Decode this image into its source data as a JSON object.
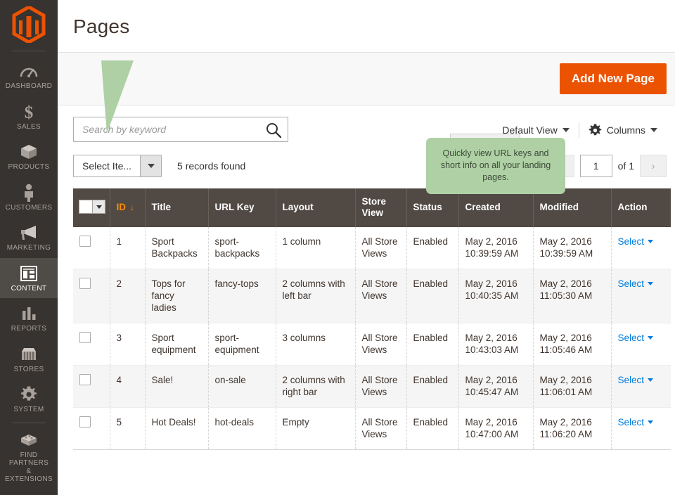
{
  "sidebar": {
    "logo_name": "magento-logo",
    "items": [
      {
        "label": "DASHBOARD",
        "icon": "dashboard-icon",
        "active": false
      },
      {
        "label": "SALES",
        "icon": "dollar-icon",
        "active": false
      },
      {
        "label": "PRODUCTS",
        "icon": "box-icon",
        "active": false
      },
      {
        "label": "CUSTOMERS",
        "icon": "person-icon",
        "active": false
      },
      {
        "label": "MARKETING",
        "icon": "megaphone-icon",
        "active": false
      },
      {
        "label": "CONTENT",
        "icon": "layout-icon",
        "active": true
      },
      {
        "label": "REPORTS",
        "icon": "bar-chart-icon",
        "active": false
      },
      {
        "label": "STORES",
        "icon": "storefront-icon",
        "active": false
      },
      {
        "label": "SYSTEM",
        "icon": "gear-icon",
        "active": false
      },
      {
        "label": "FIND PARTNERS\n& EXTENSIONS",
        "icon": "puzzle-brick-icon",
        "active": false
      }
    ]
  },
  "header": {
    "title": "Pages",
    "add_button": "Add New Page"
  },
  "toolbar": {
    "search_placeholder": "Search by keyword",
    "search_value": "",
    "default_view": "Default View",
    "columns": "Columns",
    "select_items": "Select Ite...",
    "records_found": "5 records found",
    "page_value": "1",
    "page_of": "of 1",
    "prev_glyph": "‹",
    "next_glyph": "›"
  },
  "callout": {
    "text": "Quickly view URL keys and short info on all your landing pages.",
    "color": "#aed0a4"
  },
  "grid": {
    "columns": [
      "ID",
      "Title",
      "URL Key",
      "Layout",
      "Store View",
      "Status",
      "Created",
      "Modified",
      "Action"
    ],
    "sorted_column": "ID",
    "sort_direction": "↓",
    "action_label": "Select",
    "rows": [
      {
        "id": "1",
        "title": "Sport Backpacks",
        "url_key": "sport-backpacks",
        "layout": "1 column",
        "store_view": "All Store Views",
        "status": "Enabled",
        "created": "May 2, 2016 10:39:59 AM",
        "modified": "May 2, 2016 10:39:59 AM"
      },
      {
        "id": "2",
        "title": "Tops for fancy ladies",
        "url_key": "fancy-tops",
        "layout": "2 columns with left bar",
        "store_view": "All Store Views",
        "status": "Enabled",
        "created": "May 2, 2016 10:40:35 AM",
        "modified": "May 2, 2016 11:05:30 AM"
      },
      {
        "id": "3",
        "title": "Sport equipment",
        "url_key": "sport-equipment",
        "layout": "3 columns",
        "store_view": "All Store Views",
        "status": "Enabled",
        "created": "May 2, 2016 10:43:03 AM",
        "modified": "May 2, 2016 11:05:46 AM"
      },
      {
        "id": "4",
        "title": "Sale!",
        "url_key": "on-sale",
        "layout": "2 columns with right bar",
        "store_view": "All Store Views",
        "status": "Enabled",
        "created": "May 2, 2016 10:45:47 AM",
        "modified": "May 2, 2016 11:06:01 AM"
      },
      {
        "id": "5",
        "title": "Hot Deals!",
        "url_key": "hot-deals",
        "layout": "Empty",
        "store_view": "All Store Views",
        "status": "Enabled",
        "created": "May 2, 2016 10:47:00 AM",
        "modified": "May 2, 2016 11:06:20 AM"
      }
    ]
  },
  "colors": {
    "accent_orange": "#eb5202",
    "sidebar_bg": "#373330",
    "grid_header_bg": "#514943",
    "link_blue": "#007bdb"
  }
}
